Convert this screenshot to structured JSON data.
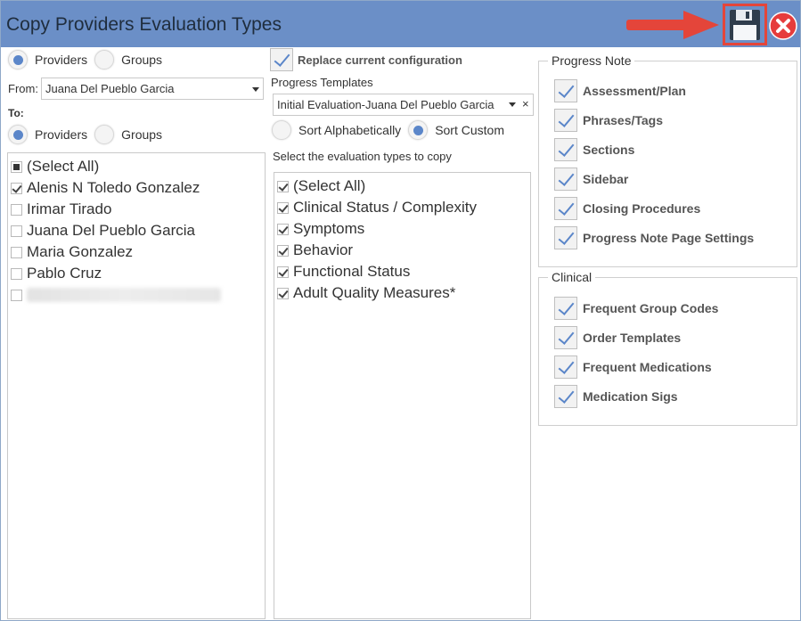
{
  "window": {
    "title": "Copy Providers Evaluation Types"
  },
  "colors": {
    "titlebar": "#6b8fc7",
    "accent": "#5b86c9",
    "highlight": "#e4453a"
  },
  "icons": {
    "save": "floppy-disk-icon",
    "close": "close-x-icon",
    "arrow": "red-arrow-annotation"
  },
  "left": {
    "source_type": {
      "providers": "Providers",
      "groups": "Groups",
      "selected": "providers"
    },
    "from_label": "From:",
    "from_value": "Juana Del Pueblo Garcia",
    "to_label": "To:",
    "target_type": {
      "providers": "Providers",
      "groups": "Groups",
      "selected": "providers"
    },
    "providers": [
      {
        "label": "(Select All)",
        "state": "partial"
      },
      {
        "label": "Alenis N Toledo Gonzalez",
        "state": "checked"
      },
      {
        "label": "Irimar Tirado",
        "state": "unchecked"
      },
      {
        "label": "Juana Del Pueblo Garcia",
        "state": "unchecked"
      },
      {
        "label": "Maria Gonzalez",
        "state": "unchecked"
      },
      {
        "label": "Pablo Cruz",
        "state": "unchecked"
      }
    ]
  },
  "middle": {
    "replace_label": "Replace current configuration",
    "replace_checked": true,
    "templates_label": "Progress Templates",
    "template_value": "Initial Evaluation-Juana Del Pueblo Garcia",
    "clear_symbol": "×",
    "sort": {
      "alpha": "Sort Alphabetically",
      "custom": "Sort Custom",
      "selected": "custom"
    },
    "eval_label": "Select the evaluation types to copy",
    "eval_types": [
      {
        "label": "(Select All)",
        "checked": true
      },
      {
        "label": "Clinical Status / Complexity",
        "checked": true
      },
      {
        "label": "Symptoms",
        "checked": true
      },
      {
        "label": "Behavior",
        "checked": true
      },
      {
        "label": "Functional Status",
        "checked": true
      },
      {
        "label": "Adult Quality Measures*",
        "checked": true
      }
    ]
  },
  "right": {
    "progress_note": {
      "legend": "Progress Note",
      "items": [
        {
          "label": "Assessment/Plan",
          "checked": true
        },
        {
          "label": "Phrases/Tags",
          "checked": true
        },
        {
          "label": "Sections",
          "checked": true
        },
        {
          "label": "Sidebar",
          "checked": true
        },
        {
          "label": "Closing Procedures",
          "checked": true
        },
        {
          "label": "Progress Note Page Settings",
          "checked": true
        }
      ]
    },
    "clinical": {
      "legend": "Clinical",
      "items": [
        {
          "label": "Frequent Group Codes",
          "checked": true
        },
        {
          "label": "Order Templates",
          "checked": true
        },
        {
          "label": "Frequent Medications",
          "checked": true
        },
        {
          "label": "Medication Sigs",
          "checked": true
        }
      ]
    }
  }
}
